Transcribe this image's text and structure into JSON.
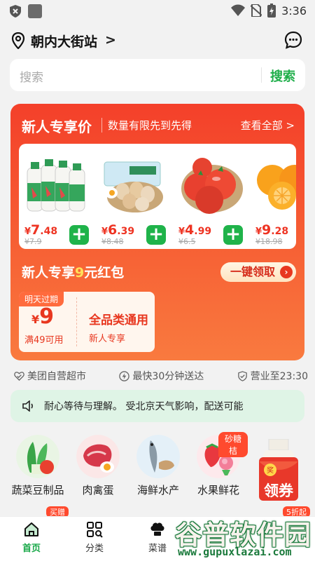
{
  "status_bar": {
    "time": "3:36",
    "icons": [
      "shield-icon",
      "app-square-icon",
      "wifi-icon",
      "no-sim-icon",
      "battery-charging-icon"
    ]
  },
  "header": {
    "location": "朝内大街站",
    "location_chevron": ">",
    "icons": [
      "location-pin-icon",
      "message-icon"
    ]
  },
  "search": {
    "placeholder": "搜索",
    "button": "搜索"
  },
  "promo": {
    "title": "新人专享价",
    "subtitle": "数量有限先到先得",
    "view_all": "查看全部 >",
    "products": [
      {
        "name": "乳酸菌饮品",
        "price_int": "7",
        "price_dec": ".48",
        "original": "¥7.9"
      },
      {
        "name": "土鸡蛋",
        "price_int": "6",
        "price_dec": ".39",
        "original": "¥8.48"
      },
      {
        "name": "番茄",
        "price_int": "4",
        "price_dec": ".99",
        "original": "¥6.5"
      },
      {
        "name": "橙子",
        "price_int": "9",
        "price_dec": ".28",
        "original": "¥18.98"
      }
    ],
    "currency": "¥",
    "packet_title_a": "新人专享",
    "packet_title_hl": "9",
    "packet_title_b": "元红包",
    "claim_button": "一键领取",
    "coupon": {
      "tag": "明天过期",
      "currency": "¥",
      "amount": "9",
      "condition": "满49可用",
      "name": "全品类通用",
      "desc": "新人专享"
    }
  },
  "features": [
    "美团自营超市",
    "最快30分钟送达",
    "营业至23:30"
  ],
  "notice": {
    "text": "耐心等待与理解。        受北京天气影响，配送可能"
  },
  "categories": [
    {
      "label": "蔬菜豆制品",
      "badge": ""
    },
    {
      "label": "肉禽蛋",
      "badge": ""
    },
    {
      "label": "海鲜水产",
      "badge": ""
    },
    {
      "label": "水果鲜花",
      "badge": "砂糖桔"
    }
  ],
  "float_coupon": {
    "label": "领券"
  },
  "peek_badges": [
    "买赠",
    "5折起"
  ],
  "tabs": [
    {
      "label": "首页",
      "active": true
    },
    {
      "label": "分类",
      "active": false
    },
    {
      "label": "菜谱",
      "active": false
    }
  ],
  "watermark": {
    "name": "谷普软件园",
    "url": "www.gupuxlazai.com"
  },
  "colors": {
    "primary_red": "#f4402a",
    "accent_green": "#1fae4a",
    "price_red": "#ee3322"
  }
}
